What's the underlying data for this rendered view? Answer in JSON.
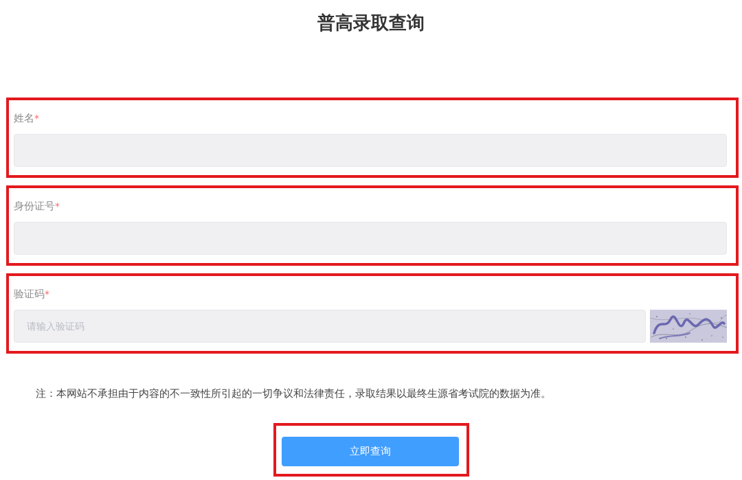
{
  "title": "普高录取查询",
  "fields": [
    {
      "kind": "text",
      "label": "姓名",
      "required_mark": "*",
      "highlighted": true
    },
    {
      "kind": "text",
      "label": "身份证号",
      "required_mark": "*",
      "highlighted": true
    },
    {
      "kind": "captcha",
      "label": "验证码",
      "required_mark": "*",
      "placeholder": "请输入验证码",
      "highlighted": true
    }
  ],
  "note": "注：本网站不承担由于内容的不一致性所引起的一切争议和法律责任，录取结果以最终生源省考试院的数据为准。",
  "submit_button": {
    "label": "立即查询",
    "highlighted": true
  }
}
